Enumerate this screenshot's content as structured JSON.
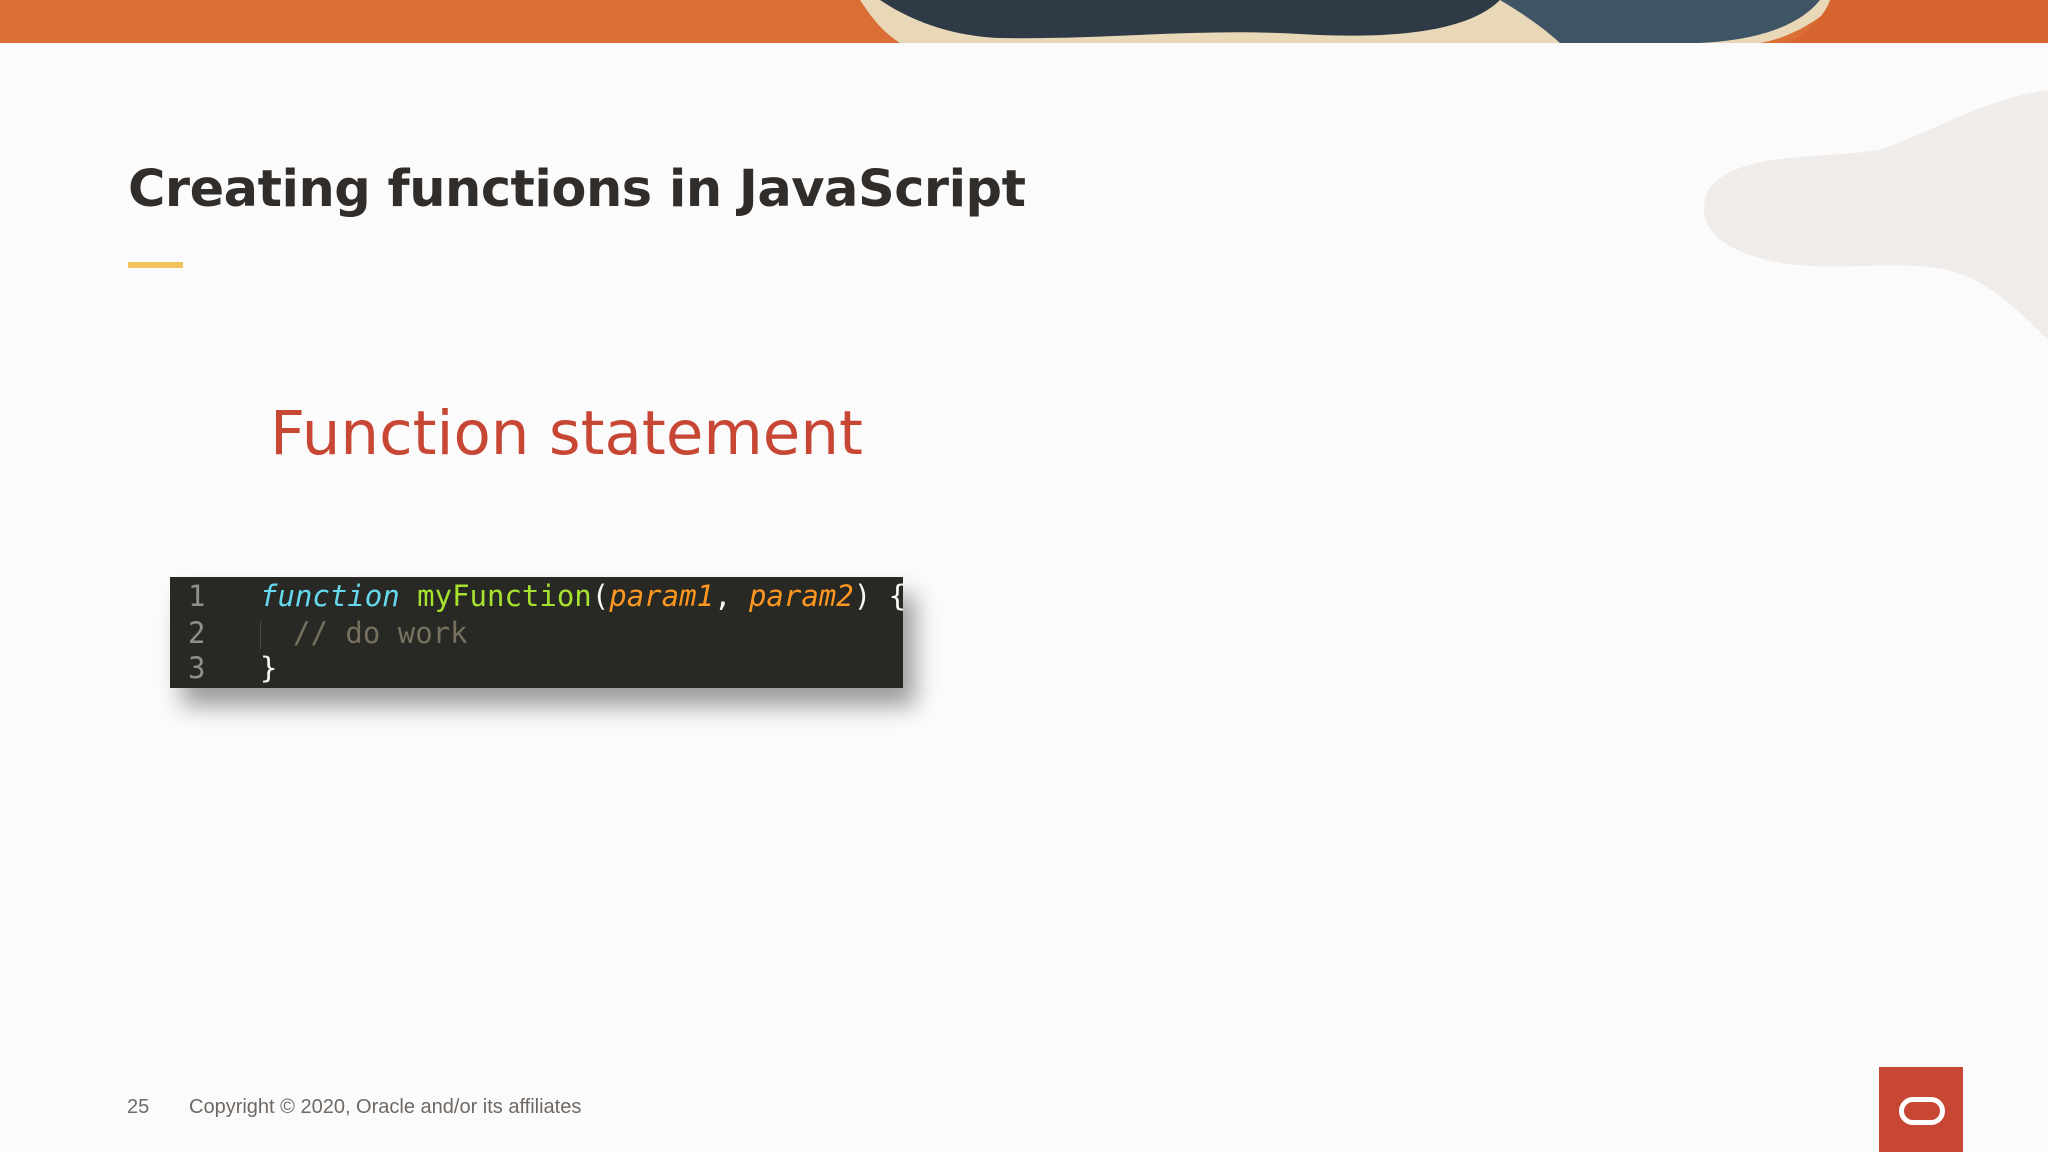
{
  "slide": {
    "title": "Creating functions in JavaScript",
    "section_heading": "Function statement"
  },
  "code": {
    "lines": [
      {
        "number": "1",
        "tokens": [
          "function",
          "myFunction",
          "(",
          "param1",
          ",",
          "param2",
          ") {"
        ]
      },
      {
        "number": "2",
        "comment": "// do work"
      },
      {
        "number": "3",
        "text": "}"
      }
    ]
  },
  "footer": {
    "page_number": "25",
    "copyright": "Copyright © 2020, Oracle and/or its affiliates"
  },
  "colors": {
    "accent_red": "#c74634",
    "accent_yellow": "#f0c25c",
    "code_bg": "#282824"
  },
  "icons": {
    "logo": "oracle-logo-icon"
  }
}
